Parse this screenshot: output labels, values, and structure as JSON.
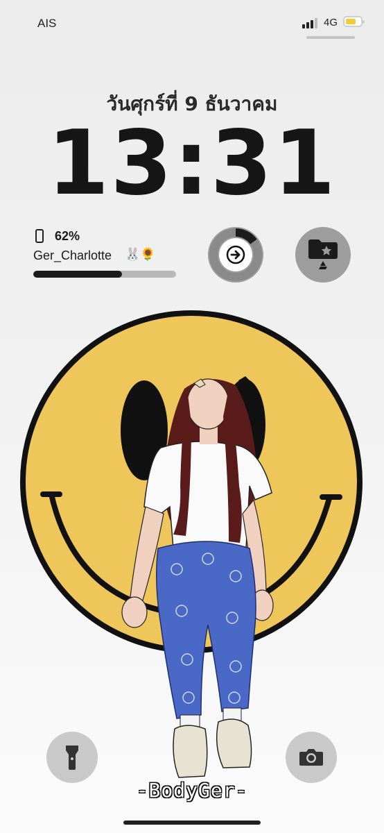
{
  "status_bar": {
    "carrier": "AIS",
    "network": "4G",
    "signal_icon": "signal-bars-icon",
    "battery_icon": "battery-icon"
  },
  "lock_screen": {
    "date": "วันศุกร์ที่ 9 ธันวาคม",
    "time": "13:31"
  },
  "widgets": {
    "battery": {
      "percent_label": "62%",
      "percent_value": 62,
      "device_name": "Ger_Charlotte",
      "device_emoji": "🐰🌻",
      "icon": "iphone-icon"
    },
    "shortcut": {
      "icon": "arrow-right-icon",
      "ring_fraction": 0.15
    },
    "files": {
      "icon": "folder-star-icon",
      "sub_icon": "google-drive-icon"
    }
  },
  "actions": {
    "flashlight_icon": "flashlight-icon",
    "camera_icon": "camera-icon"
  },
  "wallpaper": {
    "signature": "-BodyGer-",
    "colors": {
      "smiley": "#eec659",
      "pants": "#4a68c6",
      "hair": "#5a1b1b"
    }
  }
}
